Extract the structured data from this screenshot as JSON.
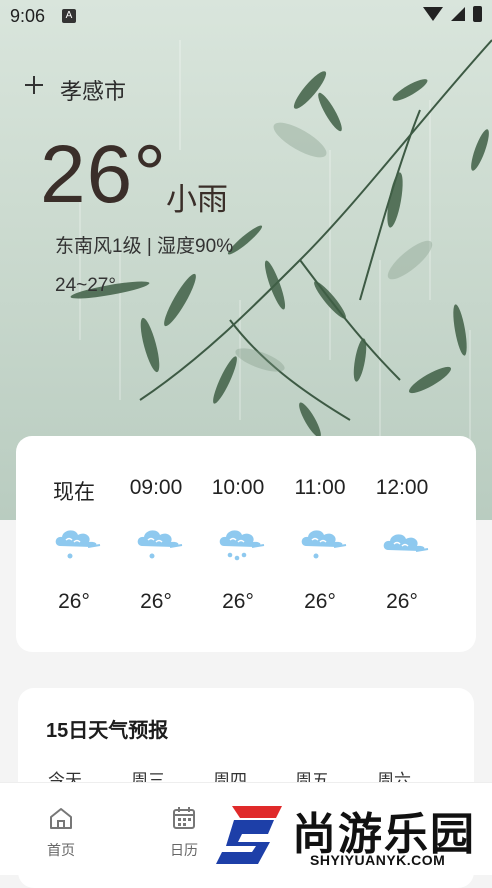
{
  "status_bar": {
    "time": "9:06",
    "notification_icon": "A"
  },
  "header": {
    "add_icon": "plus-icon",
    "city": "孝感市"
  },
  "current": {
    "temperature": "26°",
    "condition": "小雨",
    "details": "东南风1级 | 湿度90%",
    "range": "24~27°"
  },
  "hourly": [
    {
      "time": "现在",
      "icon": "cloud-rain-icon",
      "temp": "26°"
    },
    {
      "time": "09:00",
      "icon": "cloud-rain-icon",
      "temp": "26°"
    },
    {
      "time": "10:00",
      "icon": "cloud-rain-heavy-icon",
      "temp": "26°"
    },
    {
      "time": "11:00",
      "icon": "cloud-rain-icon",
      "temp": "26°"
    },
    {
      "time": "12:00",
      "icon": "cloud-icon",
      "temp": "26°"
    }
  ],
  "forecast": {
    "title": "15日天气预报",
    "days": [
      "今天",
      "周三",
      "周四",
      "周五",
      "周六"
    ]
  },
  "nav": [
    {
      "label": "首页",
      "icon": "home-icon"
    },
    {
      "label": "日历",
      "icon": "calendar-icon"
    }
  ],
  "watermark": {
    "cn": "尚游乐园",
    "en": "SHYIYUANYK.COM"
  },
  "colors": {
    "hero_bg": "#cbdacf",
    "icon_blue": "#8ec9ef",
    "watermark_blue": "#1d3fa8",
    "watermark_red": "#e02a2a"
  }
}
